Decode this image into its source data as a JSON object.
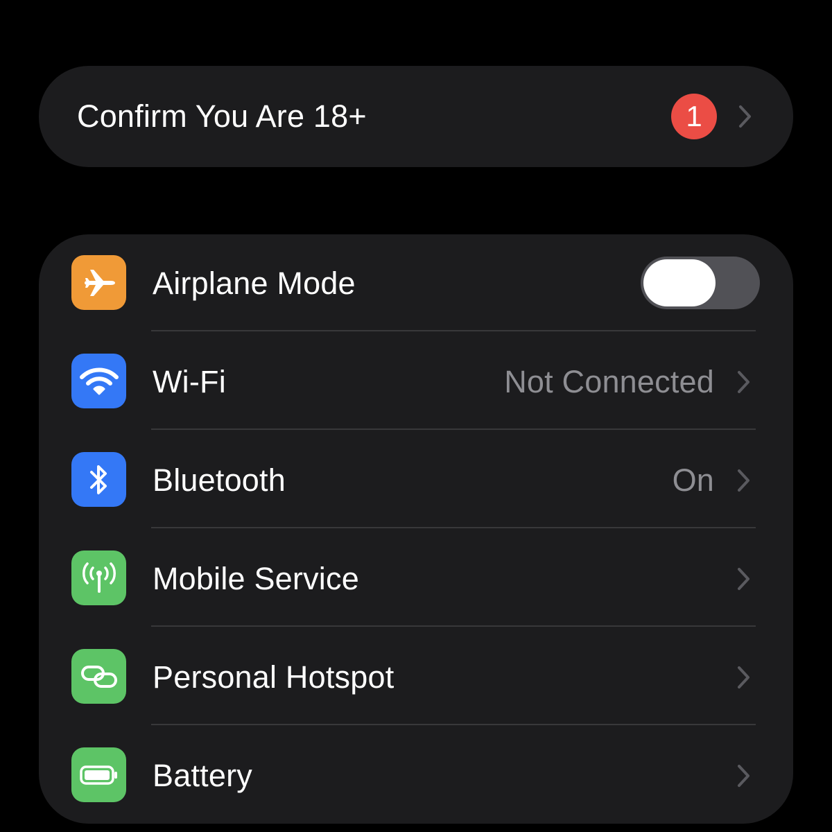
{
  "confirm_row": {
    "title": "Confirm You Are 18+",
    "badge_count": "1",
    "badge_color": "#eb4d45"
  },
  "settings": [
    {
      "label": "Airplane Mode",
      "icon": "airplane-icon",
      "icon_color": "#f09a37",
      "control": "toggle",
      "toggle_on": false
    },
    {
      "label": "Wi-Fi",
      "value": "Not Connected",
      "icon": "wifi-icon",
      "icon_color": "#3478f6",
      "control": "chevron"
    },
    {
      "label": "Bluetooth",
      "value": "On",
      "icon": "bluetooth-icon",
      "icon_color": "#3478f6",
      "control": "chevron"
    },
    {
      "label": "Mobile Service",
      "icon": "antenna-icon",
      "icon_color": "#5dc466",
      "control": "chevron"
    },
    {
      "label": "Personal Hotspot",
      "icon": "link-icon",
      "icon_color": "#5dc466",
      "control": "chevron"
    },
    {
      "label": "Battery",
      "icon": "battery-icon",
      "icon_color": "#5dc466",
      "control": "chevron"
    }
  ],
  "colors": {
    "background": "#000000",
    "card": "#1c1c1e",
    "secondary_text": "#8e8e93",
    "separator": "#38383a",
    "toggle_off_track": "#515156"
  }
}
